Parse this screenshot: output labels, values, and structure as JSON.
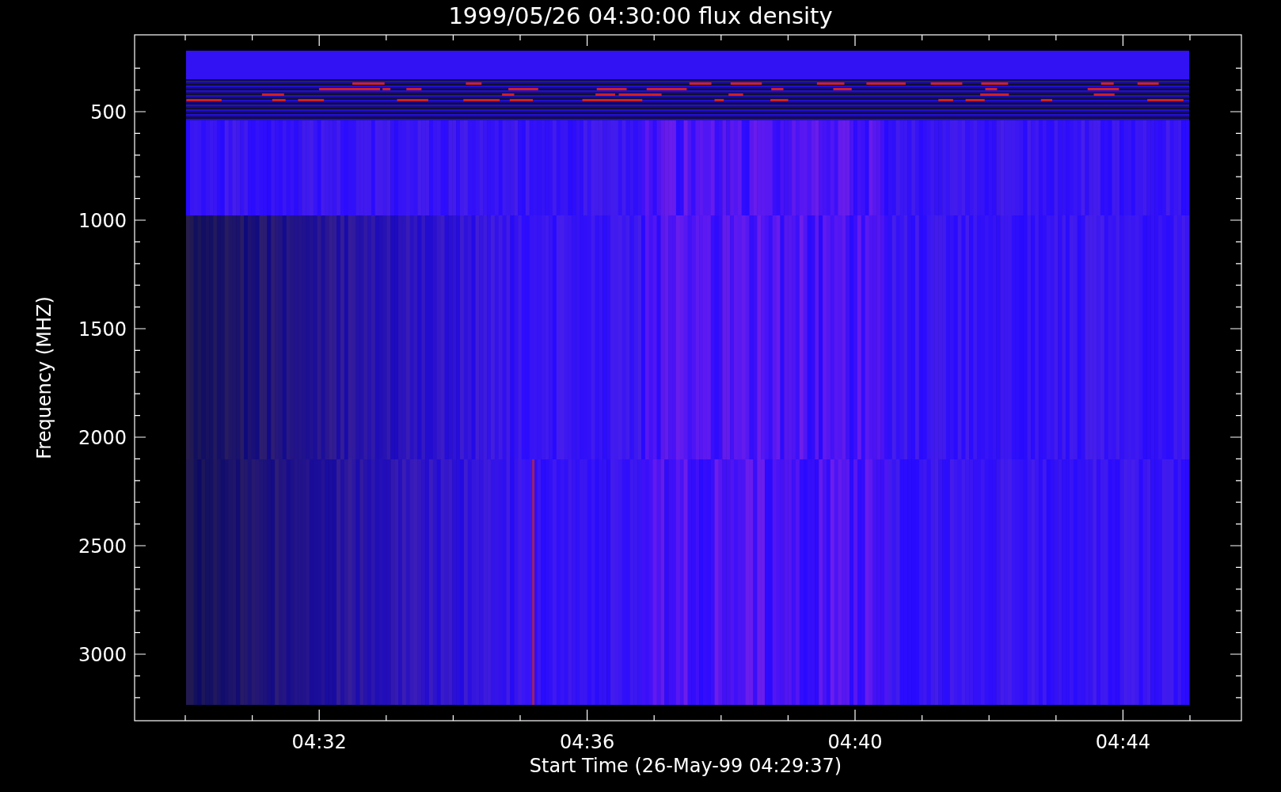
{
  "plot": {
    "title": "1999/05/26 04:30:00 flux density",
    "xlabel": "Start Time (26-May-99 04:29:37)",
    "ylabel": "Frequency (MHZ)",
    "xticks": [
      "04:32",
      "04:36",
      "04:40",
      "04:44"
    ],
    "yticks": [
      "500",
      "1000",
      "1500",
      "2000",
      "2500",
      "3000"
    ]
  }
}
